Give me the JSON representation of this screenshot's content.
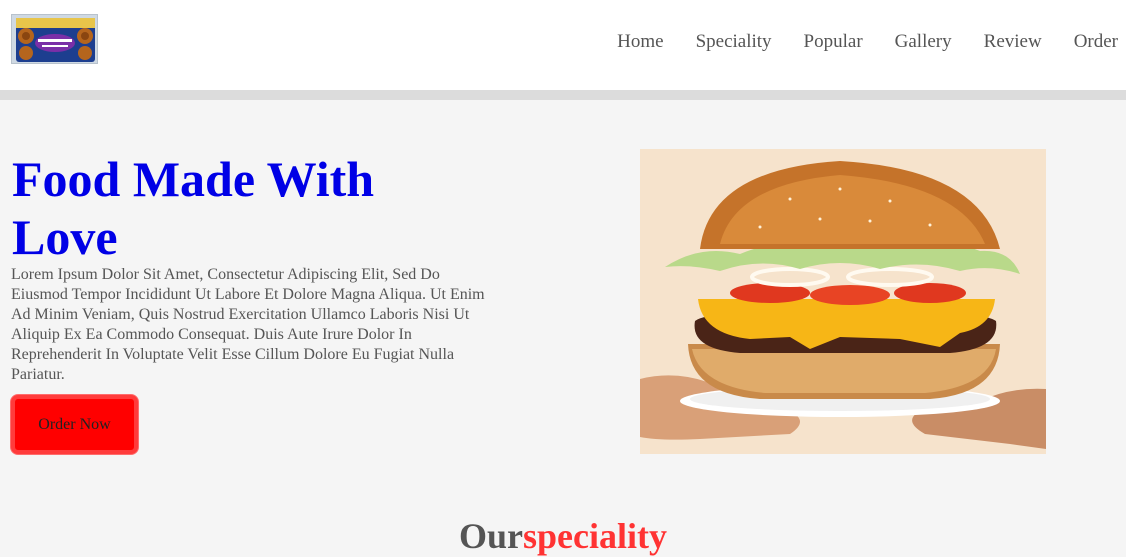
{
  "header": {
    "logo_icon": "tastykake-product-logo",
    "nav": [
      {
        "label": "Home"
      },
      {
        "label": "Speciality"
      },
      {
        "label": "Popular"
      },
      {
        "label": "Gallery"
      },
      {
        "label": "Review"
      },
      {
        "label": "Order"
      }
    ]
  },
  "hero": {
    "title": "Food Made With Love",
    "text": "Lorem Ipsum Dolor Sit Amet, Consectetur Adipiscing Elit, Sed Do Eiusmod Tempor Incididunt Ut Labore Et Dolore Magna Aliqua. Ut Enim Ad Minim Veniam, Quis Nostrud Exercitation Ullamco Laboris Nisi Ut Aliquip Ex Ea Commodo Consequat. Duis Aute Irure Dolor In Reprehenderit In Voluptate Velit Esse Cillum Dolore Eu Fugiat Nulla Pariatur.",
    "button_label": "Order Now",
    "image_icon": "burger-image"
  },
  "speciality": {
    "title_part1": "Our",
    "title_part2": "speciality"
  },
  "colors": {
    "title_blue": "#0000e6",
    "button_red": "#ff0000",
    "accent_red": "#ff3333",
    "text_gray": "#555555"
  }
}
